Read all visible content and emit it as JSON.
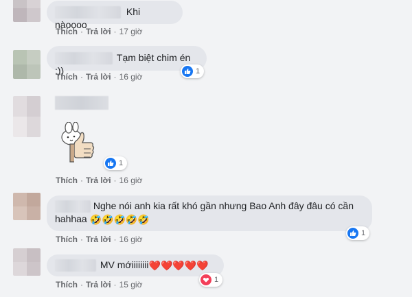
{
  "comments": [
    {
      "text": "Khi nàoooo",
      "actions": {
        "like": "Thích",
        "reply": "Trả lời",
        "time": "17 giờ"
      }
    },
    {
      "text": "Tạm biệt chim én :))",
      "actions": {
        "like": "Thích",
        "reply": "Trả lời",
        "time": "16 giờ"
      },
      "reaction": {
        "icon": "like-icon",
        "count": "1"
      }
    },
    {
      "text": "",
      "sticker": "thumbs-up-bunny-sticker",
      "actions": {
        "like": "Thích",
        "reply": "Trả lời",
        "time": "16 giờ"
      },
      "reaction": {
        "icon": "like-icon",
        "count": "1"
      }
    },
    {
      "text": "Nghe nói anh kia rất khó gần nhưng Bao Anh đây đâu có cần hahhaa",
      "text_line1": "Nghe nói anh kia rất khó gần nhưng Bao Anh đây đâu có cần",
      "text_line2": "hahhaa",
      "emoji": [
        "🤣",
        "🤣",
        "🤣",
        "🤣",
        "🤣"
      ],
      "actions": {
        "like": "Thích",
        "reply": "Trả lời",
        "time": "16 giờ"
      },
      "reaction": {
        "icon": "like-icon",
        "count": "1"
      }
    },
    {
      "text": "MV mớiiiiiiii",
      "emoji": [
        "❤️",
        "❤️",
        "❤️",
        "❤️",
        "❤️"
      ],
      "actions": {
        "like": "Thích",
        "reply": "Trả lời",
        "time": "15 giờ"
      },
      "reaction": {
        "icon": "love-icon",
        "count": "1"
      }
    }
  ],
  "colors": {
    "bubble": "#e4e6eb",
    "background": "#f2f3f5",
    "like": "#1877f2",
    "love": "#f33e58",
    "meta": "#65676b"
  }
}
